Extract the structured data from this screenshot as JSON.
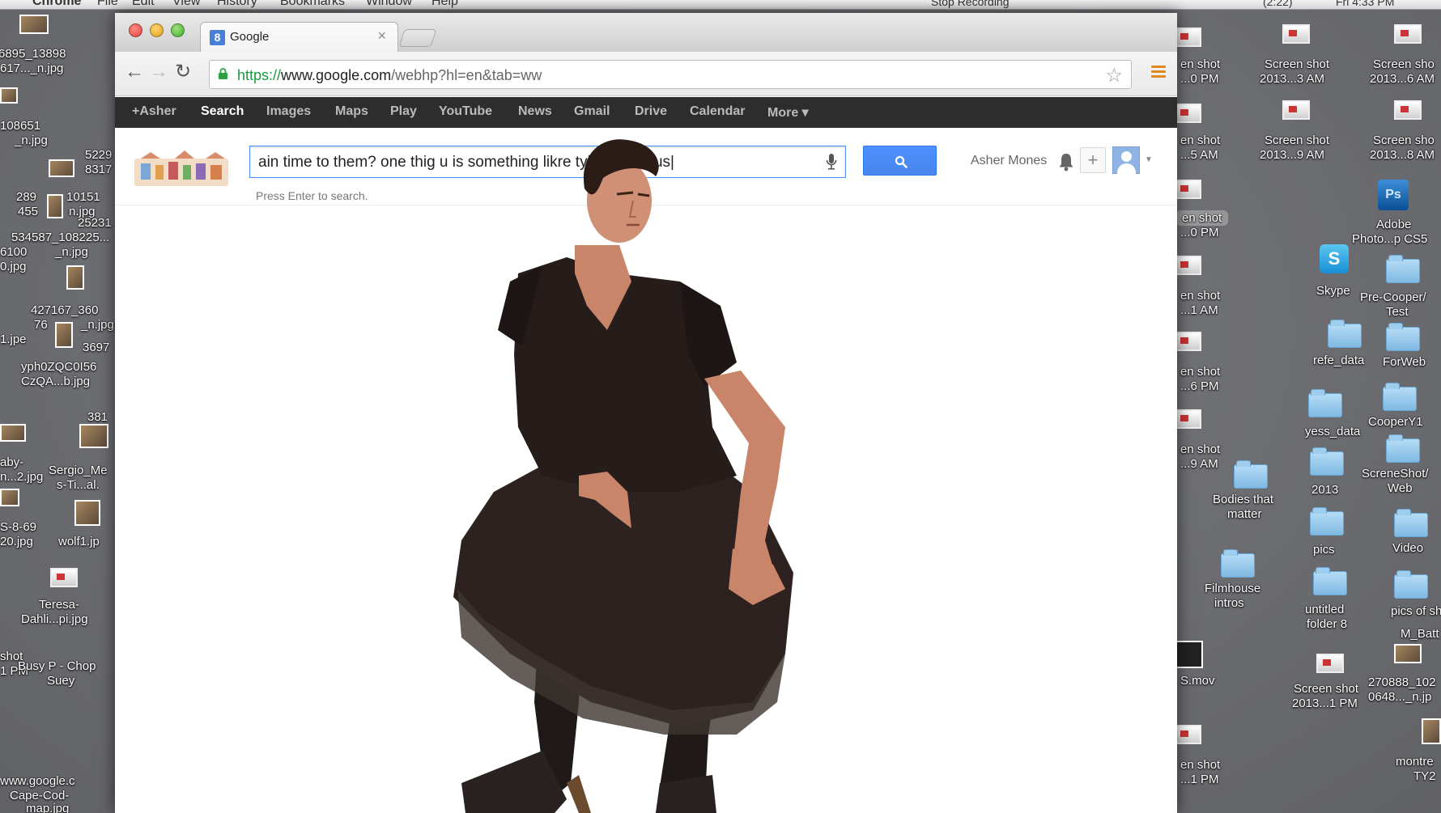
{
  "menubar": {
    "app": "Chrome",
    "menus": [
      "File",
      "Edit",
      "View",
      "History",
      "Bookmarks",
      "Window",
      "Help"
    ],
    "status_recording": "Stop Recording",
    "status_clock": "Fri 4:33 PM",
    "status_battery": "(2:22)"
  },
  "desktop": {
    "left_labels": [
      "6895_13898",
      "617..._n.jpg",
      "108651",
      "_n.jpg",
      "5229",
      "8317",
      "289",
      "10151",
      "455",
      "n.jpg",
      "25231",
      "534587_1082",
      "25...",
      "6100",
      "_n.jpg",
      "0.jpg",
      "427167_360",
      "76",
      "_n.jpg",
      "1.jpe",
      "3697",
      "yph0ZQC0I56",
      "CzQA...b.jpg",
      "381",
      "aby-",
      "n...2.jpg",
      "Sergio_Me",
      "s-Ti...al.",
      "S-8-69",
      "20.jpg",
      "wolf1.jp",
      "Teresa-",
      "Dahli...pi.jpg",
      "shot",
      "1 PM",
      "Busy P - Chop",
      "Suey",
      "www.google.c",
      "Cape-Cod-",
      "map.jpg"
    ],
    "right_labels": {
      "col1": [
        "en shot",
        "...0 PM",
        "en shot",
        "...5 AM",
        "en shot",
        "...0 PM",
        "en shot",
        "...1 AM",
        "en shot",
        "...6 PM",
        "en shot",
        "...9 AM",
        "S.mov",
        "en shot",
        "...1 PM"
      ],
      "col2": [
        "Screen shot",
        "2013...3 AM",
        "Screen shot",
        "2013...9 AM",
        "Skype",
        "refe_data",
        "yess_data",
        "2013",
        "pics",
        "untitled",
        "folder 8",
        "Screen shot",
        "2013...1 PM",
        "Bodies that",
        "matter",
        "Filmhouse",
        "intros"
      ],
      "col3": [
        "Screen sho",
        "2013...6 AM",
        "Screen sho",
        "2013...8 AM",
        "Adobe",
        "Photo...p CS5",
        "Pre-Cooper/",
        "Test",
        "ForWeb",
        "CooperY1",
        "ScreneShot/",
        "Web",
        "Video",
        "pics of sh",
        "M_Batt",
        "270888_102",
        "0648..._n.jp",
        "montre",
        "TY2"
      ]
    }
  },
  "browser": {
    "tab_title": "Google",
    "tab_favicon": "8",
    "url_scheme": "https://",
    "url_host": "www.google.com",
    "url_path": "/webhp?hl=en&tab=ww"
  },
  "gbar": {
    "items": [
      "+Asher",
      "Search",
      "Images",
      "Maps",
      "Play",
      "YouTube",
      "News",
      "Gmail",
      "Drive",
      "Calendar",
      "More ▾"
    ]
  },
  "google": {
    "search_value": "ain time to them? one thig u    is something likre tyhe luminous|",
    "hint": "Press Enter to search.",
    "username": "Asher Mones",
    "share_label": "+"
  },
  "colors": {
    "accent": "#4d90fe",
    "gbar": "#2d2d2d",
    "secure": "#1a9a3a",
    "menu_icon": "#e08a1e"
  }
}
